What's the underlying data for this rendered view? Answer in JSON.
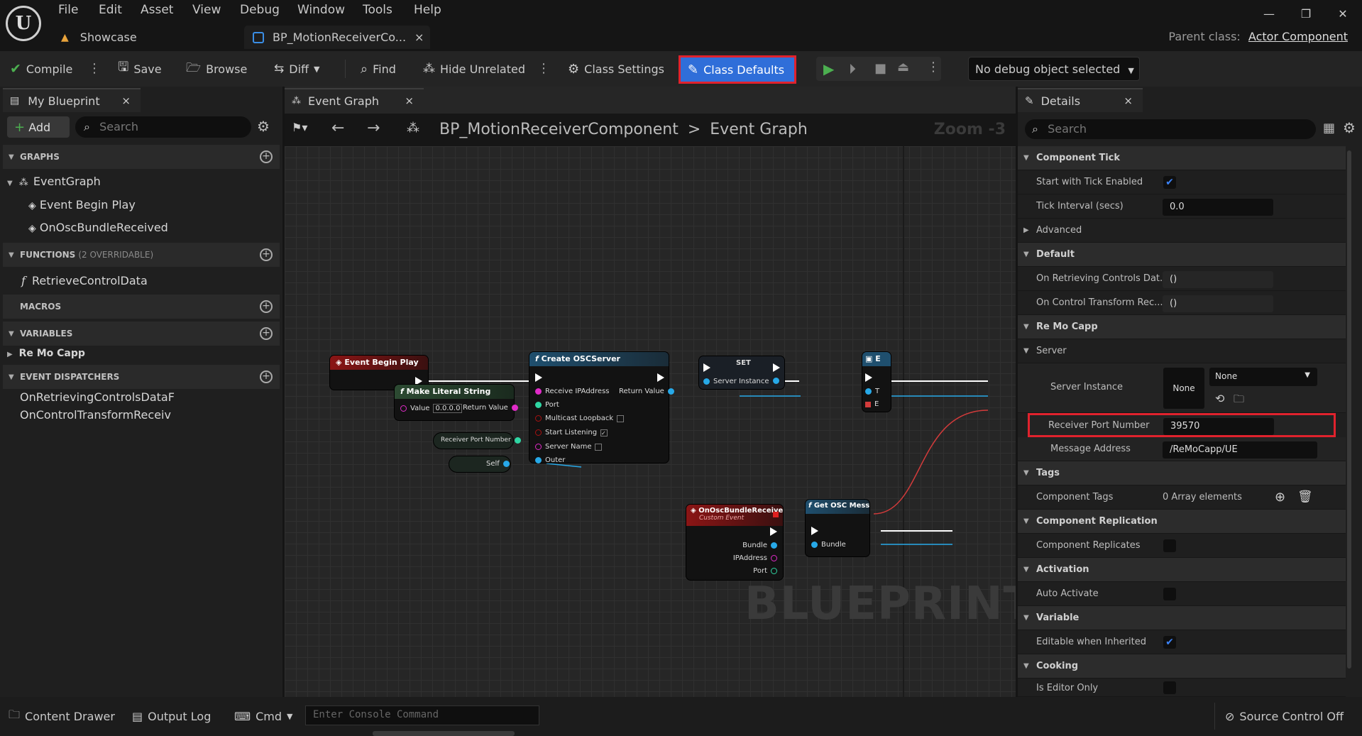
{
  "menu": [
    "File",
    "Edit",
    "Asset",
    "View",
    "Debug",
    "Window",
    "Tools",
    "Help"
  ],
  "tabs": {
    "showcase": "Showcase",
    "blueprint": "BP_MotionReceiverCo...",
    "close": "×"
  },
  "parent_class": {
    "label": "Parent class:",
    "value": "Actor Component"
  },
  "toolbar": {
    "compile": "Compile",
    "save": "Save",
    "browse": "Browse",
    "diff": "Diff",
    "find": "Find",
    "hide_unrelated": "Hide Unrelated",
    "class_settings": "Class Settings",
    "class_defaults": "Class Defaults",
    "debug_object": "No debug object selected"
  },
  "left": {
    "tab": "My Blueprint",
    "add": "Add",
    "search_placeholder": "Search",
    "graphs": {
      "title": "GRAPHS",
      "items": [
        "EventGraph",
        "Event Begin Play",
        "OnOscBundleReceived"
      ]
    },
    "functions": {
      "title": "FUNCTIONS",
      "count": "(2 OVERRIDABLE)",
      "items": [
        "RetrieveControlData"
      ]
    },
    "macros": "MACROS",
    "variables": {
      "title": "VARIABLES",
      "items": [
        "Re Mo Capp"
      ]
    },
    "dispatchers": {
      "title": "EVENT DISPATCHERS",
      "items": [
        "OnRetrievingControlsDataF",
        "OnControlTransformReceiv"
      ]
    }
  },
  "graph": {
    "tab": "Event Graph",
    "breadcrumb_root": "BP_MotionReceiverComponent",
    "breadcrumb_sep": ">",
    "breadcrumb_leaf": "Event Graph",
    "zoom": "Zoom -3",
    "watermark": "BLUEPRINT",
    "nodes": {
      "begin_play": {
        "title": "Event Begin Play"
      },
      "make_literal": {
        "title": "Make Literal String",
        "value_label": "Value",
        "value": "0.0.0.0",
        "return": "Return Value"
      },
      "receiver_port": {
        "title": "Receiver Port Number"
      },
      "self": {
        "title": "Self"
      },
      "create_osc": {
        "title": "Create OSCServer",
        "pins": [
          "Receive IPAddress",
          "Port",
          "Multicast Loopback",
          "Start Listening",
          "Server Name",
          "Outer"
        ],
        "return": "Return Value"
      },
      "set": {
        "title": "SET",
        "pin": "Server Instance"
      },
      "on_osc": {
        "title": "OnOscBundleReceived",
        "subtitle": "Custom Event",
        "pins": [
          "Bundle",
          "IPAddress",
          "Port"
        ]
      },
      "get_osc": {
        "title": "Get OSC Mess",
        "pin": "Bundle"
      },
      "partial": {
        "title": "E",
        "pin1": "T",
        "pin2": "E"
      }
    }
  },
  "details": {
    "tab": "Details",
    "search_placeholder": "Search",
    "component_tick": "Component Tick",
    "start_tick": "Start with Tick Enabled",
    "tick_interval": "Tick Interval (secs)",
    "tick_interval_value": "0.0",
    "advanced": "Advanced",
    "default": "Default",
    "on_retrieving": "On Retrieving Controls Dat...",
    "on_retrieving_value": "()",
    "on_control": "On Control Transform Rec...",
    "on_control_value": "()",
    "remocapp": "Re Mo Capp",
    "server": "Server",
    "server_instance": "Server Instance",
    "server_instance_value": "None",
    "server_dropdown": "None",
    "receiver_port": "Receiver Port Number",
    "receiver_port_value": "39570",
    "message_address": "Message Address",
    "message_address_value": "/ReMoCapp/UE",
    "tags": "Tags",
    "component_tags": "Component Tags",
    "component_tags_value": "0 Array elements",
    "replication": "Component Replication",
    "replicates": "Component Replicates",
    "activation": "Activation",
    "auto_activate": "Auto Activate",
    "variable": "Variable",
    "editable_inherited": "Editable when Inherited",
    "cooking": "Cooking",
    "editor_only": "Is Editor Only"
  },
  "status": {
    "content_drawer": "Content Drawer",
    "output_log": "Output Log",
    "cmd": "Cmd",
    "console_placeholder": "Enter Console Command",
    "source_control": "Source Control Off"
  },
  "colors": {
    "highlight": "#e0222d",
    "accent": "#2f6ed9",
    "event": "#7a1414",
    "function": "#1f4f6e",
    "exec": "#ffffff",
    "string_pin": "#e12bc8",
    "object_pin": "#27a9e8",
    "int_pin": "#2fd6a3"
  }
}
